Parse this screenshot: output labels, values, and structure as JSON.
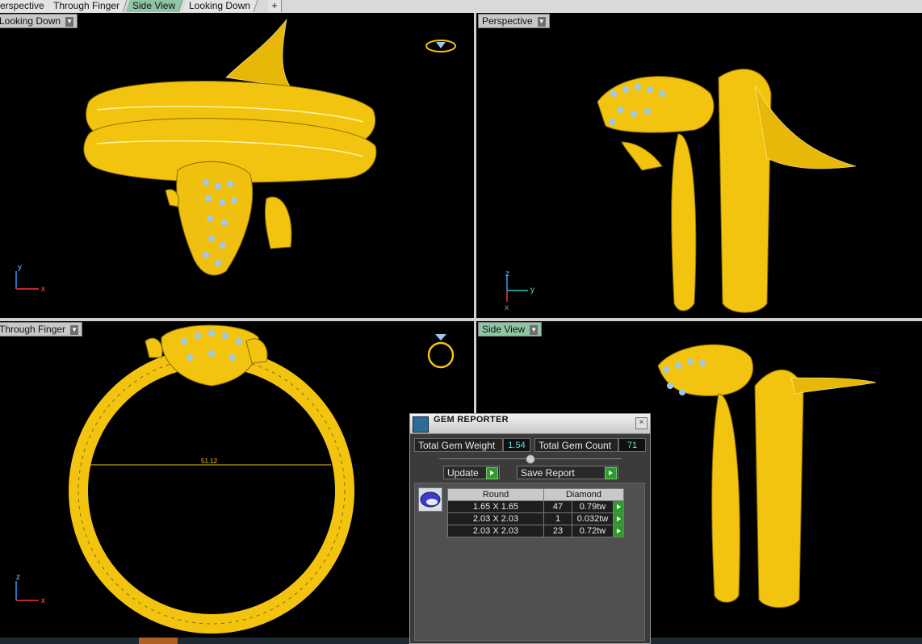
{
  "tabs": [
    {
      "label": "Perspective",
      "active": false
    },
    {
      "label": "Through Finger",
      "active": false
    },
    {
      "label": "Side View",
      "active": true
    },
    {
      "label": "Looking Down",
      "active": false
    }
  ],
  "tab_add": "+",
  "viewports": {
    "top_left": {
      "label": "Looking Down",
      "axis_a": "y",
      "axis_b": "x"
    },
    "top_right": {
      "label": "Perspective",
      "axis_a": "z",
      "axis_b": "y",
      "axis_c": "x"
    },
    "bottom_left": {
      "label": "Through Finger",
      "axis_a": "z",
      "axis_b": "x",
      "measure": "51.12"
    },
    "bottom_right": {
      "label": "Side View"
    }
  },
  "gem_reporter": {
    "title": "GEM REPORTER",
    "close": "×",
    "total_weight_label": "Total Gem Weight",
    "total_weight_value": "1.54",
    "total_count_label": "Total Gem Count",
    "total_count_value": "71",
    "update_label": "Update",
    "save_report_label": "Save Report",
    "table": {
      "headers": [
        "Round",
        "Diamond"
      ],
      "rows": [
        {
          "size": "1.65 X 1.65",
          "count": "47",
          "weight": "0.79tw"
        },
        {
          "size": "2.03 X 2.03",
          "count": "1",
          "weight": "0.032tw"
        },
        {
          "size": "2.03 X 2.03",
          "count": "23",
          "weight": "0.72tw"
        }
      ]
    }
  },
  "colors": {
    "gold": "#f2c40f",
    "gem": "#9ec8f0",
    "viewport_bg": "#000000",
    "active_tab": "#8ec5a3"
  }
}
